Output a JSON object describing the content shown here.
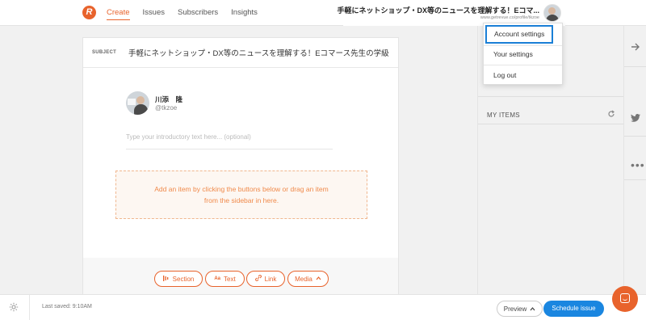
{
  "topbar": {
    "logo": "R",
    "nav": [
      {
        "label": "Create",
        "active": true
      },
      {
        "label": "Issues",
        "active": false
      },
      {
        "label": "Subscribers",
        "active": false
      },
      {
        "label": "Insights",
        "active": false
      }
    ],
    "profile_name": "手軽にネットショップ・DX等のニュースを理解する！Eコマ...",
    "profile_url": "www.getrevue.co/profile/tkzoe"
  },
  "dropdown": {
    "items": [
      "Account settings",
      "Your settings",
      "Log out"
    ]
  },
  "editor": {
    "subject_label": "SUBJECT",
    "subject": "手軽にネットショップ・DX等のニュースを理解する！Eコマース先生の学級",
    "author_name": "川添　隆",
    "author_handle": "@tkzoe",
    "intro_placeholder": "Type your introductory text here... (optional)",
    "dropzone_line1": "Add an item by clicking the buttons below or drag an item",
    "dropzone_line2": "from the sidebar in here.",
    "buttons": {
      "section": "Section",
      "text": "Text",
      "link": "Link",
      "media": "Media"
    }
  },
  "sidebar": {
    "my_items": "MY ITEMS"
  },
  "bottombar": {
    "last_saved": "Last saved: 9:10AM",
    "preview": "Preview",
    "schedule": "Schedule issue"
  },
  "colors": {
    "accent": "#e8632c",
    "primary_blue": "#1a86e0",
    "highlight_border": "#1a7fd6"
  },
  "icons": {
    "logo": "revue-logo-icon",
    "arrow": "arrow-right-icon",
    "twitter": "twitter-icon",
    "more": "more-dots-icon",
    "refresh": "refresh-icon",
    "gear": "gear-icon",
    "chat": "chat-icon"
  }
}
